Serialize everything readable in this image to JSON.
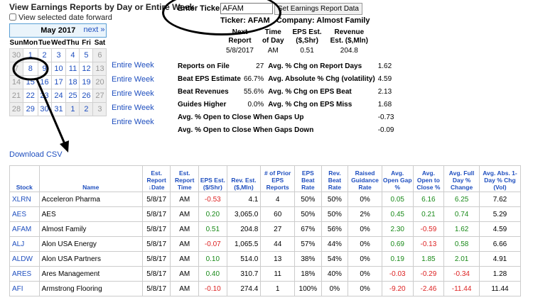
{
  "page": {
    "title": "View Earnings Reports by Day or Entire Week",
    "view_forward_label": "View selected date forward",
    "download_csv": "Download CSV"
  },
  "calendar": {
    "month_label": "May 2017",
    "next_label": "next »",
    "dow": [
      "Sun",
      "Mon",
      "Tue",
      "Wed",
      "Thu",
      "Fri",
      "Sat"
    ],
    "weeks": [
      [
        "30",
        "1",
        "2",
        "3",
        "4",
        "5",
        "6"
      ],
      [
        "7",
        "8",
        "9",
        "10",
        "11",
        "12",
        "13"
      ],
      [
        "14",
        "15",
        "16",
        "17",
        "18",
        "19",
        "20"
      ],
      [
        "21",
        "22",
        "23",
        "24",
        "25",
        "26",
        "27"
      ],
      [
        "28",
        "29",
        "30",
        "31",
        "1",
        "2",
        "3"
      ]
    ],
    "entire_week": "Entire Week"
  },
  "ticker": {
    "label": "Enter Ticker:",
    "value": "AFAM",
    "button": "Set Earnings Report Data",
    "info": "Ticker: AFAM   Company: Almost Family"
  },
  "report": {
    "headers": [
      [
        "Next",
        "Report"
      ],
      [
        "Time",
        "of Day"
      ],
      [
        "EPS Est.",
        "($,Shr)"
      ],
      [
        "Revenue",
        "Est. ($,Mln)"
      ]
    ],
    "values": [
      "5/8/2017",
      "AM",
      "0.51",
      "204.8"
    ]
  },
  "stats": [
    {
      "l1": "Reports on File",
      "v1": "27",
      "l2": "Avg. % Chg on Report Days",
      "v2": "1.62"
    },
    {
      "l1": "Beat EPS Estimate",
      "v1": "66.7%",
      "l2": "Avg. Absolute % Chg (volatility)",
      "v2": "4.59"
    },
    {
      "l1": "Beat Revenues",
      "v1": "55.6%",
      "l2": "Avg. % Chg on EPS Beat",
      "v2": "2.13"
    },
    {
      "l1": "Guides Higher",
      "v1": "0.0%",
      "l2": "Avg. % Chg on EPS Miss",
      "v2": "1.68"
    }
  ],
  "stats_wide": [
    {
      "l": "Avg. % Open to Close When Gaps Up",
      "v": "-0.73"
    },
    {
      "l": "Avg. % Open to Close When Gaps Down",
      "v": "-0.09"
    }
  ],
  "table": {
    "headers": [
      "Stock",
      "Name",
      "Est. Report ↓Date",
      "Est. Report Time",
      "EPS Est. ($/Shr)",
      "Rev. Est. ($,Mln)",
      "# of Prior EPS Reports",
      "EPS Beat Rate",
      "Rev. Beat Rate",
      "Raised Guidance Rate",
      "Avg. Open Gap %",
      "Avg. Open to Close %",
      "Avg. Full Day % Change",
      "Avg. Abs. 1-Day % Chg (Vol)"
    ],
    "rows": [
      [
        "XLRN",
        "Acceleron Pharma",
        "5/8/17",
        "AM",
        "-0.53",
        "4.1",
        "4",
        "50%",
        "50%",
        "0%",
        "0.05",
        "6.16",
        "6.25",
        "7.62"
      ],
      [
        "AES",
        "AES",
        "5/8/17",
        "AM",
        "0.20",
        "3,065.0",
        "60",
        "50%",
        "50%",
        "2%",
        "0.45",
        "0.21",
        "0.74",
        "5.29"
      ],
      [
        "AFAM",
        "Almost Family",
        "5/8/17",
        "AM",
        "0.51",
        "204.8",
        "27",
        "67%",
        "56%",
        "0%",
        "2.30",
        "-0.59",
        "1.62",
        "4.59"
      ],
      [
        "ALJ",
        "Alon USA Energy",
        "5/8/17",
        "AM",
        "-0.07",
        "1,065.5",
        "44",
        "57%",
        "44%",
        "0%",
        "0.69",
        "-0.13",
        "0.58",
        "6.66"
      ],
      [
        "ALDW",
        "Alon USA Partners",
        "5/8/17",
        "AM",
        "0.10",
        "514.0",
        "13",
        "38%",
        "54%",
        "0%",
        "0.19",
        "1.85",
        "2.01",
        "4.91"
      ],
      [
        "ARES",
        "Ares Management",
        "5/8/17",
        "AM",
        "0.40",
        "310.7",
        "11",
        "18%",
        "40%",
        "0%",
        "-0.03",
        "-0.29",
        "-0.34",
        "1.28"
      ],
      [
        "AFI",
        "Armstrong Flooring",
        "5/8/17",
        "AM",
        "-0.10",
        "274.4",
        "1",
        "100%",
        "0%",
        "0%",
        "-9.20",
        "-2.46",
        "-11.44",
        "11.44"
      ]
    ]
  },
  "colors": {
    "link": "#1f4fbf",
    "positive": "#1a8a1a",
    "negative": "#dd2222",
    "cal_border": "#5a9fd4"
  }
}
